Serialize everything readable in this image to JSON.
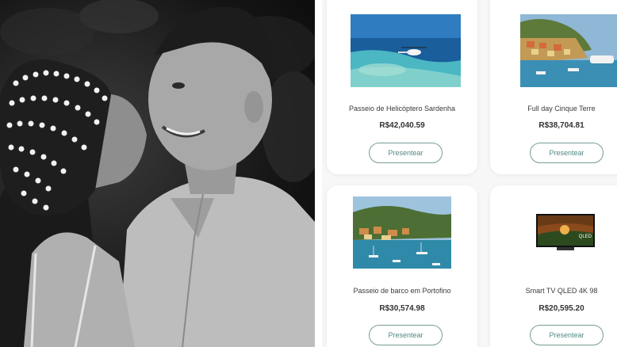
{
  "products": [
    {
      "name": "Passeio de Helicóptero Sardenha",
      "price": "R$42,040.59",
      "button": "Presentear",
      "image": "helicopter-sea-image"
    },
    {
      "name": "Full day Cinque Terre",
      "price": "R$38,704.81",
      "button": "Presentear",
      "image": "cinque-terre-harbor-image"
    },
    {
      "name": "Passeio de barco em Portofino",
      "price": "R$30,574.98",
      "button": "Presentear",
      "image": "portofino-bay-image"
    },
    {
      "name": "Smart TV QLED 4K 98",
      "price": "R$20,595.20",
      "button": "Presentear",
      "image": "smart-tv-image"
    }
  ],
  "tv_badge": "QLED",
  "colors": {
    "button_border": "#7a9c97",
    "button_text": "#4f8a83",
    "page_bg": "#f6f7f6"
  }
}
